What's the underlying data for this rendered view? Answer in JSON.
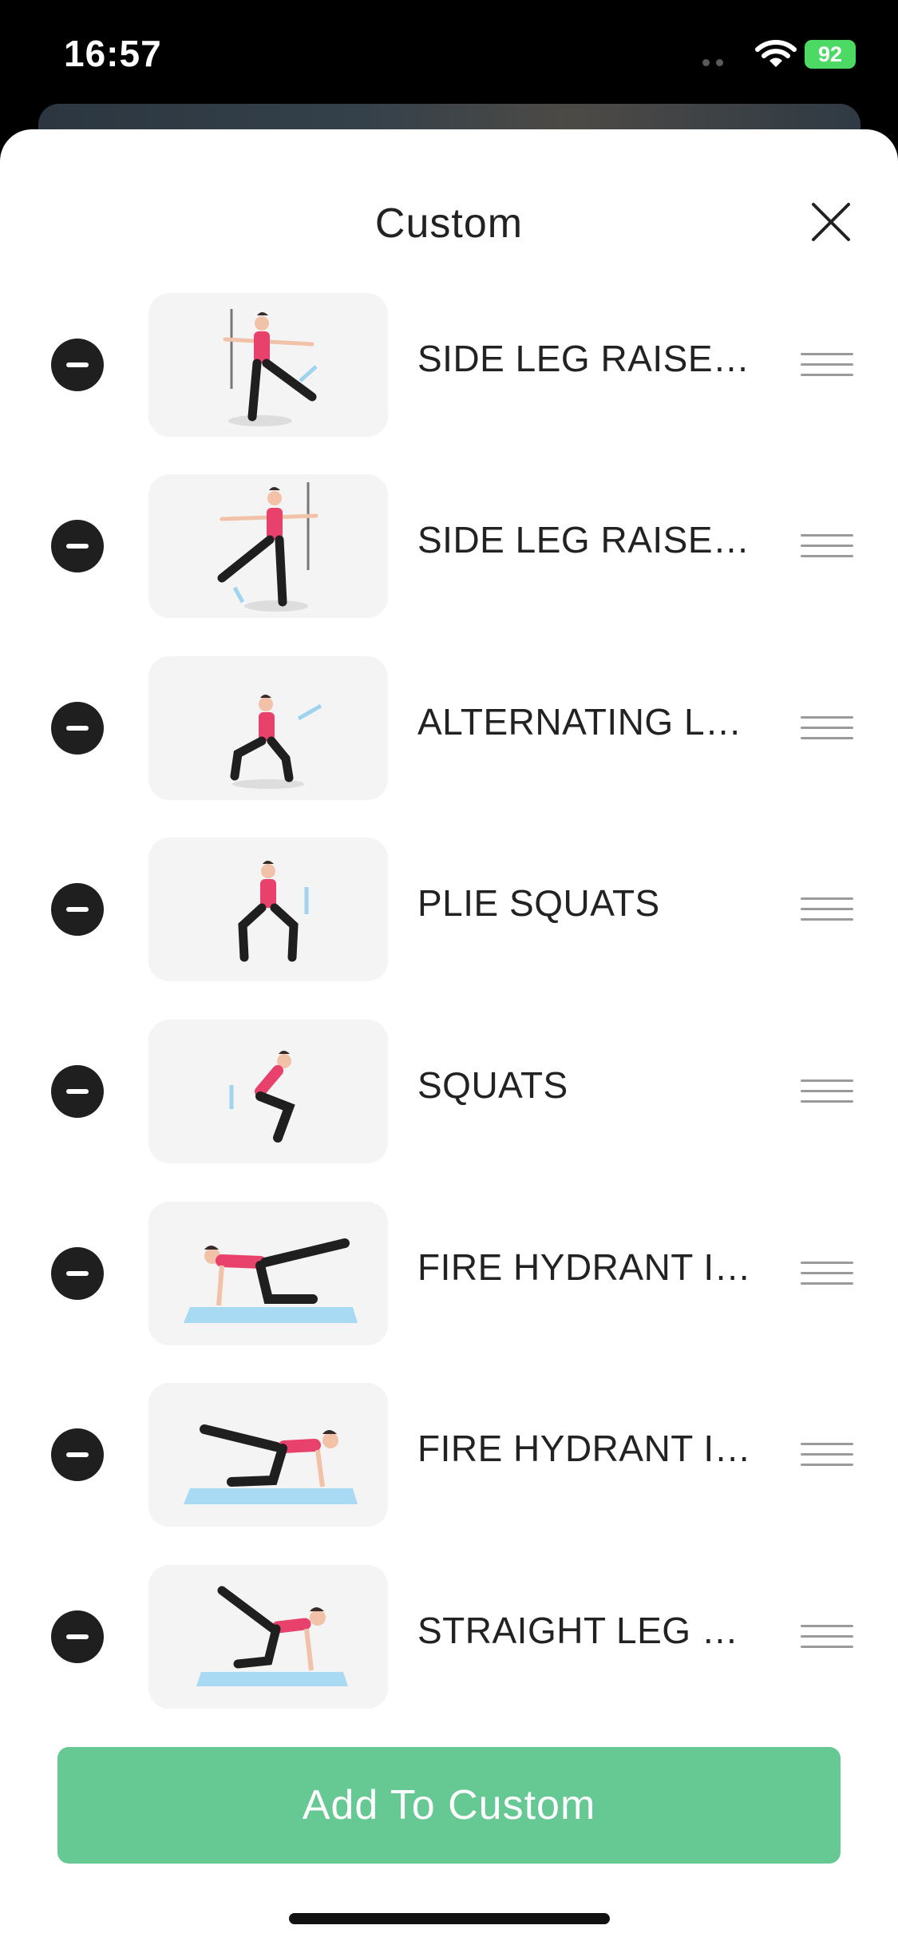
{
  "status_bar": {
    "time": "16:57",
    "battery": "92"
  },
  "sheet": {
    "title": "Custom"
  },
  "exercises": [
    {
      "name": "SIDE LEG RAISES...",
      "illustration": "side-leg-raise-left"
    },
    {
      "name": "SIDE LEG RAISES...",
      "illustration": "side-leg-raise-right"
    },
    {
      "name": "ALTERNATING LU...",
      "illustration": "lunge"
    },
    {
      "name": "PLIE SQUATS",
      "illustration": "plie-squat"
    },
    {
      "name": "SQUATS",
      "illustration": "squat"
    },
    {
      "name": "FIRE HYDRANT IN...",
      "illustration": "fire-hydrant-right"
    },
    {
      "name": "FIRE HYDRANT IN...",
      "illustration": "fire-hydrant-left"
    },
    {
      "name": "STRAIGHT LEG KI...",
      "illustration": "straight-leg-kickback"
    }
  ],
  "add_button": {
    "label": "Add To Custom"
  },
  "colors": {
    "accent": "#66c893",
    "figure_top": "#e8416b",
    "figure_legs": "#1f1f1f",
    "mat": "#a9daf4"
  }
}
